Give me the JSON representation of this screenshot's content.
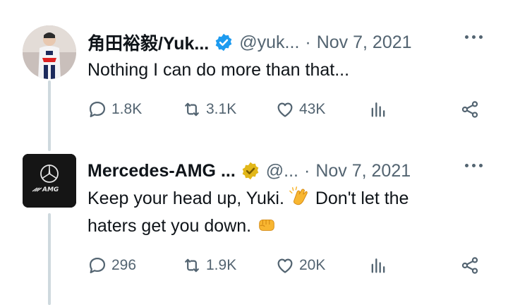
{
  "tweets": [
    {
      "name": "角田裕毅/Yuk...",
      "handle": "@yuk...",
      "separator": "·",
      "date": "Nov 7, 2021",
      "badge": "blue-verified-icon",
      "text": "Nothing I can do more than that...",
      "replies": "1.8K",
      "retweets": "3.1K",
      "likes": "43K"
    },
    {
      "name": "Mercedes-AMG ...",
      "handle": "@...",
      "separator": "·",
      "date": "Nov 7, 2021",
      "badge": "gold-verified-icon",
      "text_part1": "Keep your head up, Yuki.",
      "text_part2": "Don't let the",
      "text_line2": "haters get you down.",
      "replies": "296",
      "retweets": "1.9K",
      "likes": "20K",
      "logo_text": "AMG"
    }
  ],
  "colors": {
    "accent_blue": "#1d9bf0",
    "gold_badge": "#e2b719",
    "muted": "#536471",
    "thread_line": "#cfd9de"
  }
}
